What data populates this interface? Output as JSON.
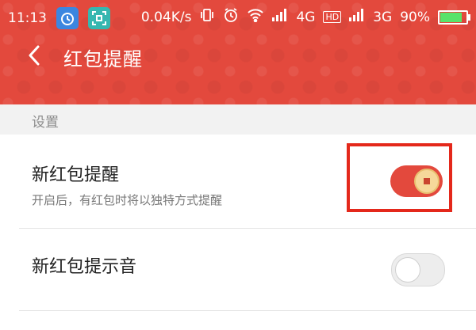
{
  "status_bar": {
    "time": "11:13",
    "speed": "0.04K/s",
    "network_4g": "4G",
    "hd_badge": "HD",
    "network_3g": "3G",
    "battery": "90%",
    "battery_level": 0.9,
    "icons": [
      "alarm-app-icon",
      "scan-app-icon",
      "vibrate-icon",
      "alarm-clock-icon",
      "wifi-icon",
      "signal-icon",
      "signal-icon",
      "battery-icon"
    ]
  },
  "header": {
    "back_icon": "chevron-left-icon",
    "title": "红包提醒",
    "color": "#e3493d"
  },
  "section": {
    "label": "设置"
  },
  "settings": [
    {
      "title": "新红包提醒",
      "subtitle": "开启后，有红包时将以独特方式提醒",
      "enabled": true
    },
    {
      "title": "新红包提示音",
      "subtitle": "",
      "enabled": false
    }
  ]
}
